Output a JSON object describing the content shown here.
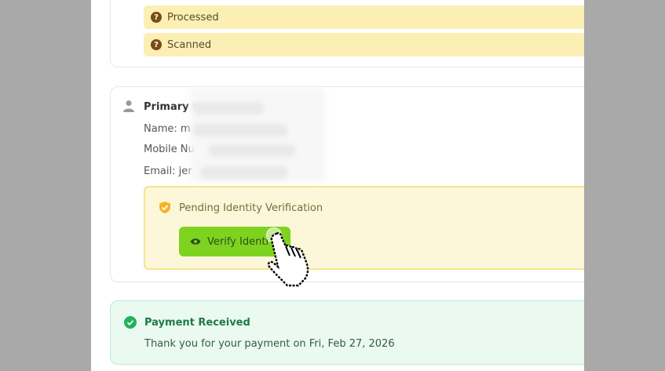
{
  "status_list": [
    {
      "label": "Processed",
      "icon": "question-circle-icon"
    },
    {
      "label": "Scanned",
      "icon": "question-circle-icon"
    }
  ],
  "primary": {
    "title": "Primary C",
    "name_label": "Name: m",
    "mobile_label": "Mobile Nu",
    "email_label": "Email: jer"
  },
  "verification": {
    "status_text": "Pending Identity Verification",
    "button_label": "Verify Identi"
  },
  "payment": {
    "title": "Payment Received",
    "message": "Thank you for your payment on Fri, Feb 27, 2026"
  },
  "colors": {
    "accent_green": "#7ed321",
    "pending_bg": "#fdf7d9",
    "payment_bg": "#ebfaf1",
    "status_bg": "#fcefb4"
  }
}
